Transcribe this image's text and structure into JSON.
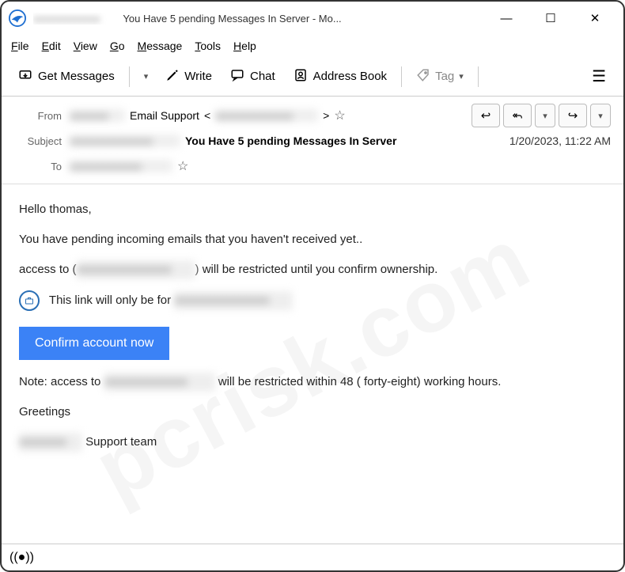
{
  "window": {
    "title_visible": "You Have 5 pending Messages In Server - Mo..."
  },
  "menubar": {
    "file": "File",
    "edit": "Edit",
    "view": "View",
    "go": "Go",
    "message": "Message",
    "tools": "Tools",
    "help": "Help"
  },
  "toolbar": {
    "get_messages": "Get Messages",
    "write": "Write",
    "chat": "Chat",
    "address_book": "Address Book",
    "tag": "Tag"
  },
  "headers": {
    "from_label": "From",
    "from_name": "Email Support",
    "from_email_prefix": "<",
    "from_email_suffix": ">",
    "subject_label": "Subject",
    "subject_bold": "You Have 5 pending Messages In Server",
    "to_label": "To",
    "date": "1/20/2023, 11:22 AM"
  },
  "body": {
    "greeting": "Hello thomas,",
    "line1": "You have pending incoming emails that you haven't received yet..",
    "line2_pre": "access to (",
    "line2_post": ") will be restricted until you confirm ownership.",
    "line3_pre": "This link will only be for ",
    "button": "Confirm account now",
    "note_pre": "Note: access to ",
    "note_post": " will be restricted within 48 ( forty-eight) working hours.",
    "greetings": "Greetings",
    "signature_post": "Support team"
  },
  "watermark": "pcrisk.com"
}
